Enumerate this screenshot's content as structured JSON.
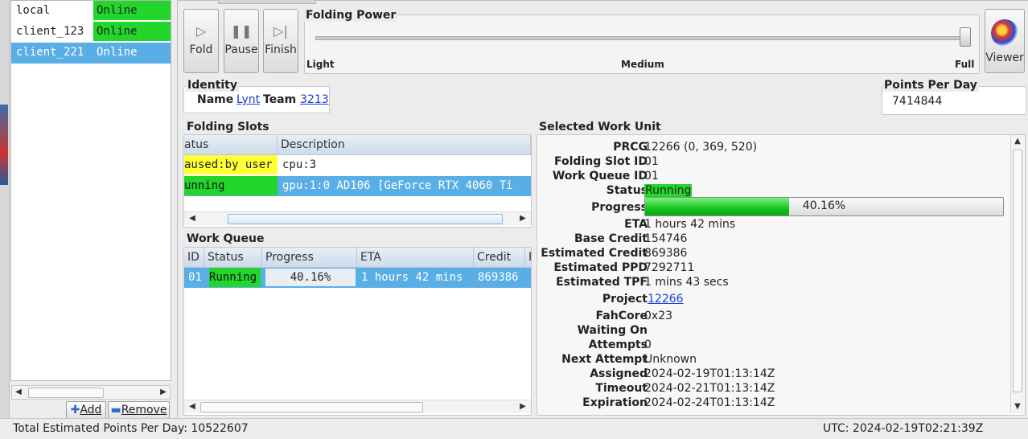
{
  "clients": [
    {
      "name": "local",
      "status": "Online"
    },
    {
      "name": "client_123",
      "status": "Online"
    },
    {
      "name": "client_221",
      "status": "Online"
    }
  ],
  "client_buttons": {
    "add": "Add",
    "remove": "Remove"
  },
  "toolbar": {
    "fold": "Fold",
    "pause": "Pause",
    "finish": "Finish",
    "viewer": "Viewer"
  },
  "folding_power": {
    "title": "Folding Power",
    "light": "Light",
    "medium": "Medium",
    "full": "Full",
    "level": 1.0
  },
  "identity": {
    "title": "Identity",
    "name_label": "Name",
    "name": "Lynt",
    "team_label": "Team",
    "team": "3213"
  },
  "ppd": {
    "title": "Points Per Day",
    "value": "7414844"
  },
  "folding_slots": {
    "title": "Folding Slots",
    "columns": [
      "atus",
      "Description"
    ],
    "rows": [
      {
        "status": "aused:by user",
        "description": "cpu:3"
      },
      {
        "status": "unning",
        "description": "gpu:1:0 AD106 [GeForce RTX 4060 Ti"
      }
    ]
  },
  "work_queue": {
    "title": "Work Queue",
    "columns": [
      "ID",
      "Status",
      "Progress",
      "ETA",
      "Credit",
      "F"
    ],
    "rows": [
      {
        "id": "01",
        "status": "Running",
        "progress": "40.16%",
        "eta": "1 hours 42 mins",
        "credit": "869386"
      }
    ]
  },
  "selected_wu": {
    "title": "Selected Work Unit",
    "fields": [
      {
        "label": "PRCG",
        "value": "12266 (0, 369, 520)"
      },
      {
        "label": "Folding Slot ID",
        "value": "01"
      },
      {
        "label": "Work Queue ID",
        "value": "01"
      },
      {
        "label": "Status",
        "value": "Running"
      },
      {
        "label": "Progress",
        "value": "40.16%"
      },
      {
        "label": "ETA",
        "value": "1 hours 42 mins"
      },
      {
        "label": "Base Credit",
        "value": "154746"
      },
      {
        "label": "Estimated Credit",
        "value": "869386"
      },
      {
        "label": "Estimated PPD",
        "value": "7292711"
      },
      {
        "label": "Estimated TPF",
        "value": "1 mins 43 secs"
      },
      {
        "label": "Project",
        "value": "12266"
      },
      {
        "label": "FahCore",
        "value": "0x23"
      },
      {
        "label": "Waiting On",
        "value": ""
      },
      {
        "label": "Attempts",
        "value": "0"
      },
      {
        "label": "Next Attempt",
        "value": "Unknown"
      },
      {
        "label": "Assigned",
        "value": "2024-02-19T01:13:14Z"
      },
      {
        "label": "Timeout",
        "value": "2024-02-21T01:13:14Z"
      },
      {
        "label": "Expiration",
        "value": "2024-02-24T01:13:14Z"
      }
    ],
    "progress_fraction": 0.4016
  },
  "status_bar": {
    "total_ppd": "Total Estimated Points Per Day: 10522607",
    "utc": "UTC: 2024-02-19T02:21:39Z"
  },
  "colors": {
    "online": "#22d62b",
    "selected": "#5aaee6",
    "paused": "#ffff33",
    "link": "#1a3fd6"
  }
}
